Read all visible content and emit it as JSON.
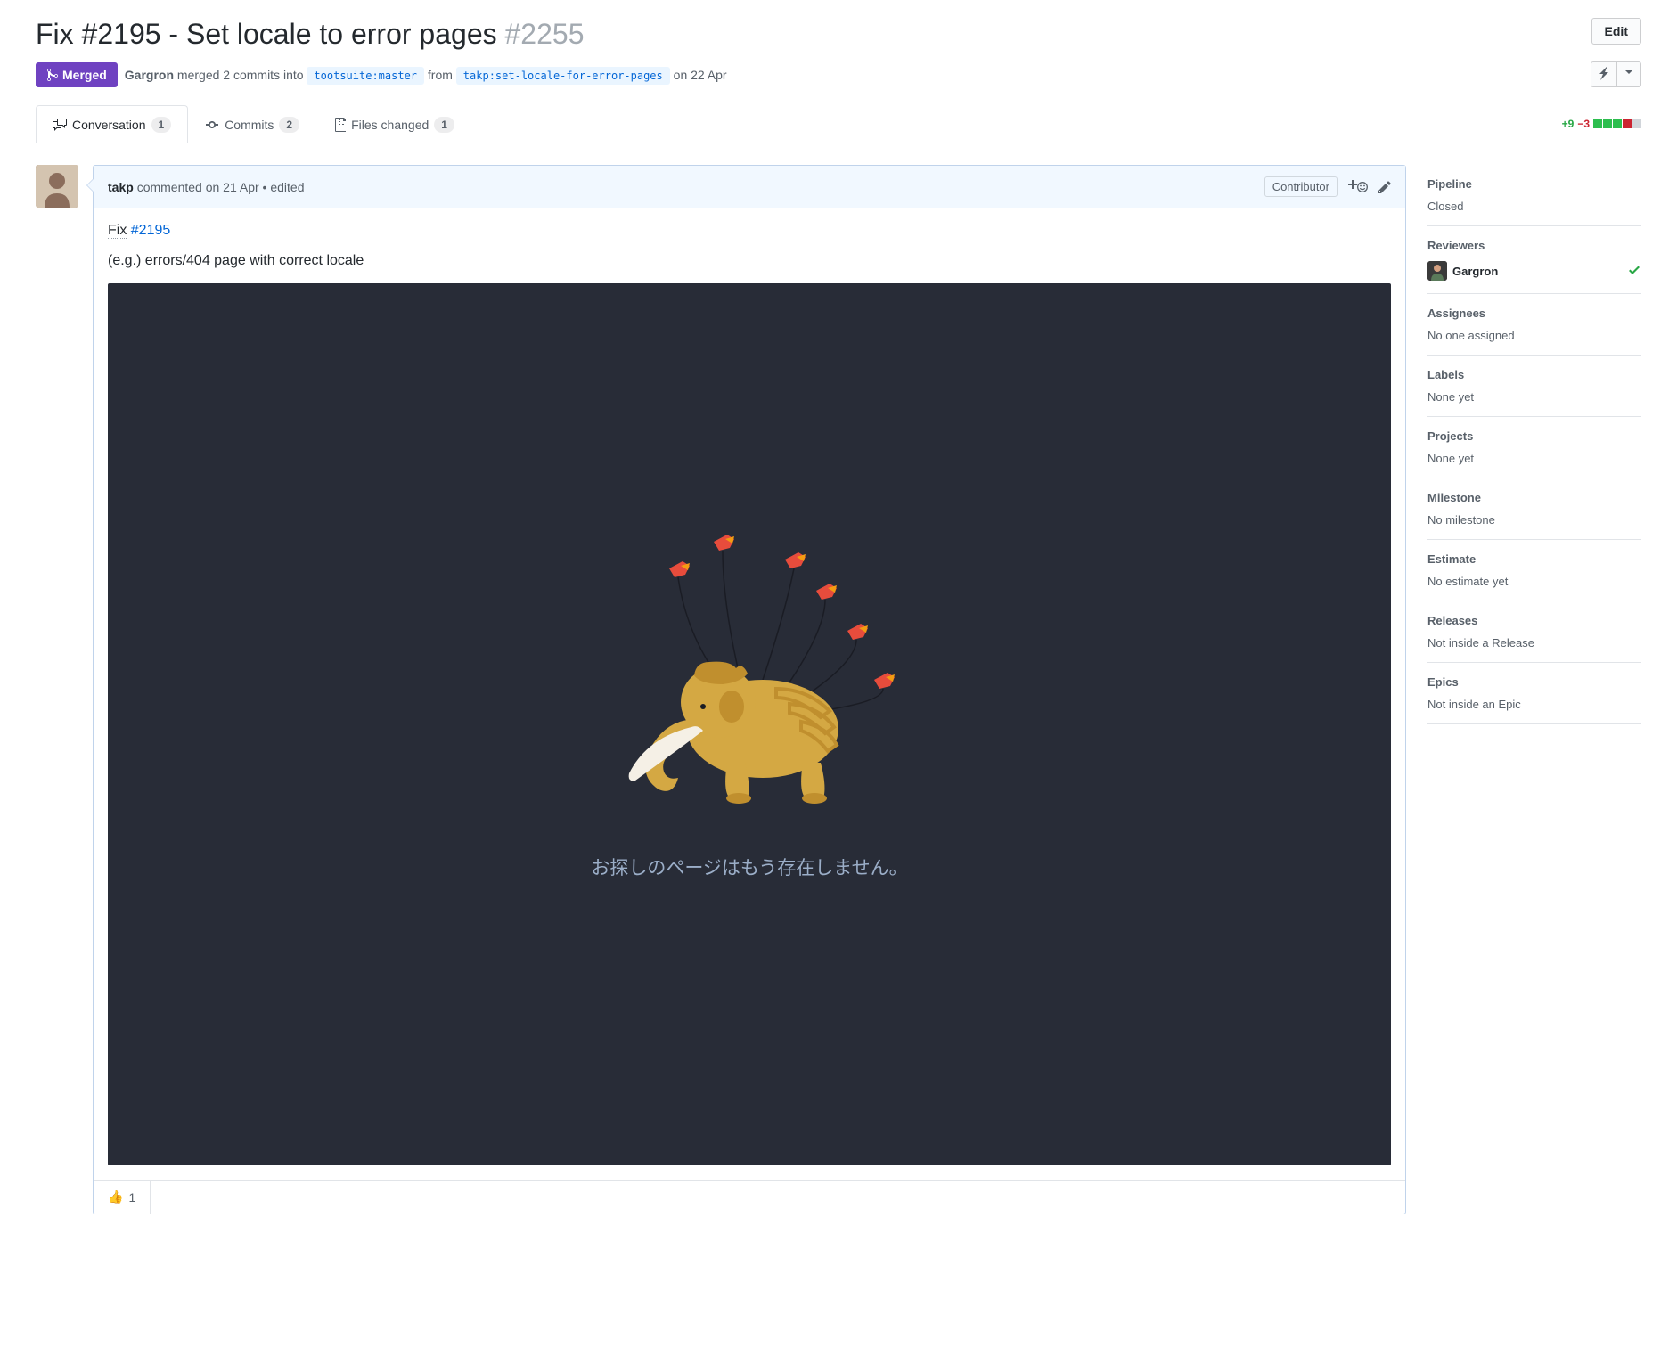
{
  "title": {
    "text": "Fix #2195 - Set locale to error pages",
    "number": "#2255"
  },
  "edit_button": "Edit",
  "state": "Merged",
  "merge_info": {
    "author": "Gargron",
    "action": "merged 2 commits into",
    "base_branch": "tootsuite:master",
    "from_word": "from",
    "head_branch": "takp:set-locale-for-error-pages",
    "date": "on 22 Apr"
  },
  "tabs": {
    "conversation": {
      "label": "Conversation",
      "count": "1"
    },
    "commits": {
      "label": "Commits",
      "count": "2"
    },
    "files": {
      "label": "Files changed",
      "count": "1"
    }
  },
  "diffstat": {
    "additions": "+9",
    "deletions": "−3"
  },
  "comment": {
    "author": "takp",
    "meta": "commented on 21 Apr • edited",
    "contributor_badge": "Contributor",
    "body_fix": "Fix",
    "body_issue": "#2195",
    "body_desc": "(e.g.) errors/404 page with correct locale",
    "error_message": "お探しのページはもう存在しません。",
    "reaction_emoji": "👍",
    "reaction_count": "1"
  },
  "sidebar": {
    "pipeline": {
      "title": "Pipeline",
      "value": "Closed"
    },
    "reviewers": {
      "title": "Reviewers",
      "name": "Gargron"
    },
    "assignees": {
      "title": "Assignees",
      "value": "No one assigned"
    },
    "labels": {
      "title": "Labels",
      "value": "None yet"
    },
    "projects": {
      "title": "Projects",
      "value": "None yet"
    },
    "milestone": {
      "title": "Milestone",
      "value": "No milestone"
    },
    "estimate": {
      "title": "Estimate",
      "value": "No estimate yet"
    },
    "releases": {
      "title": "Releases",
      "value": "Not inside a Release"
    },
    "epics": {
      "title": "Epics",
      "value": "Not inside an Epic"
    }
  }
}
